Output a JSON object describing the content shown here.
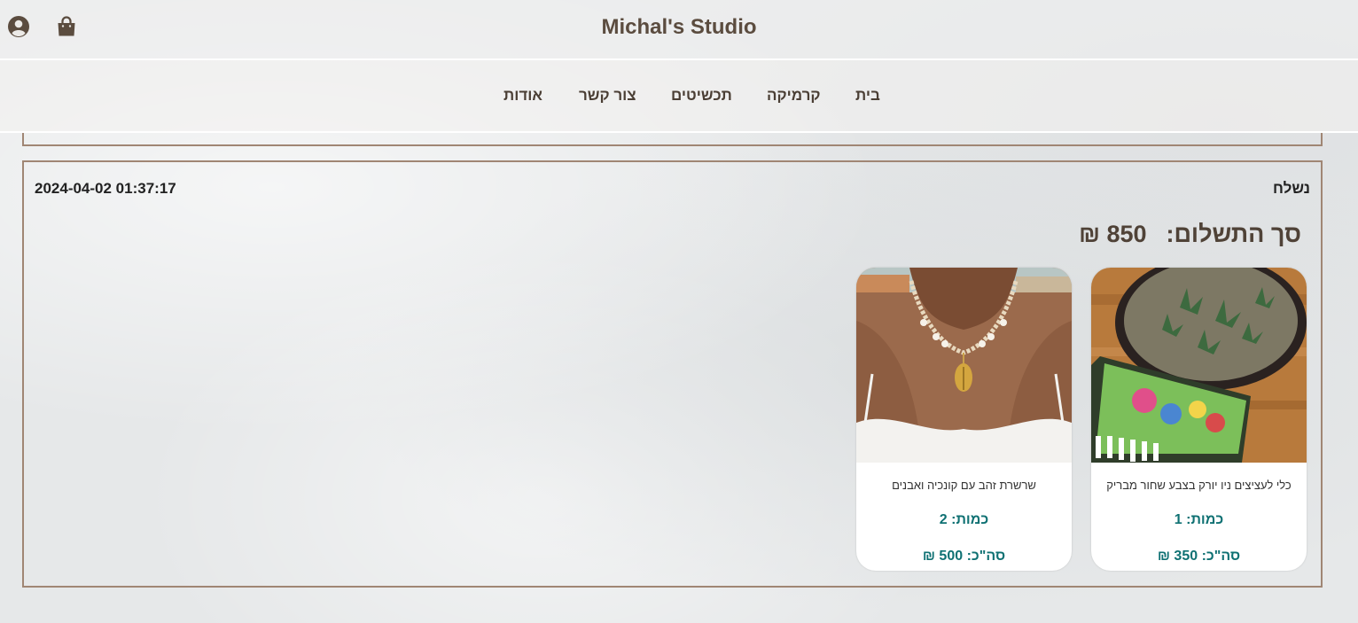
{
  "header": {
    "brand": "Michal's Studio",
    "icons": [
      "user-circle-icon",
      "shopping-bag-icon"
    ]
  },
  "nav": {
    "items": [
      {
        "label": "בית"
      },
      {
        "label": "קרמיקה"
      },
      {
        "label": "תכשיטים"
      },
      {
        "label": "צור קשר"
      },
      {
        "label": "אודות"
      }
    ]
  },
  "order": {
    "status": "נשלח",
    "datetime": "2024-04-02 01:37:17",
    "total_label": "סך התשלום:",
    "total_value": "850 ₪",
    "items": [
      {
        "name": "כלי לעציצים ניו יורק בצבע שחור מבריק",
        "qty": "כמות: 1",
        "sum": "סה\"כ: 350 ₪",
        "image": "ceramic-planter-photo"
      },
      {
        "name": "שרשרת זהב עם קונכיה ואבנים",
        "qty": "כמות: 2",
        "sum": "סה\"כ: 500 ₪",
        "image": "shell-necklace-photo"
      }
    ]
  },
  "colors": {
    "brand_text": "#5b4c3f",
    "panel_border": "#a08674",
    "accent_teal": "#0f7173"
  }
}
